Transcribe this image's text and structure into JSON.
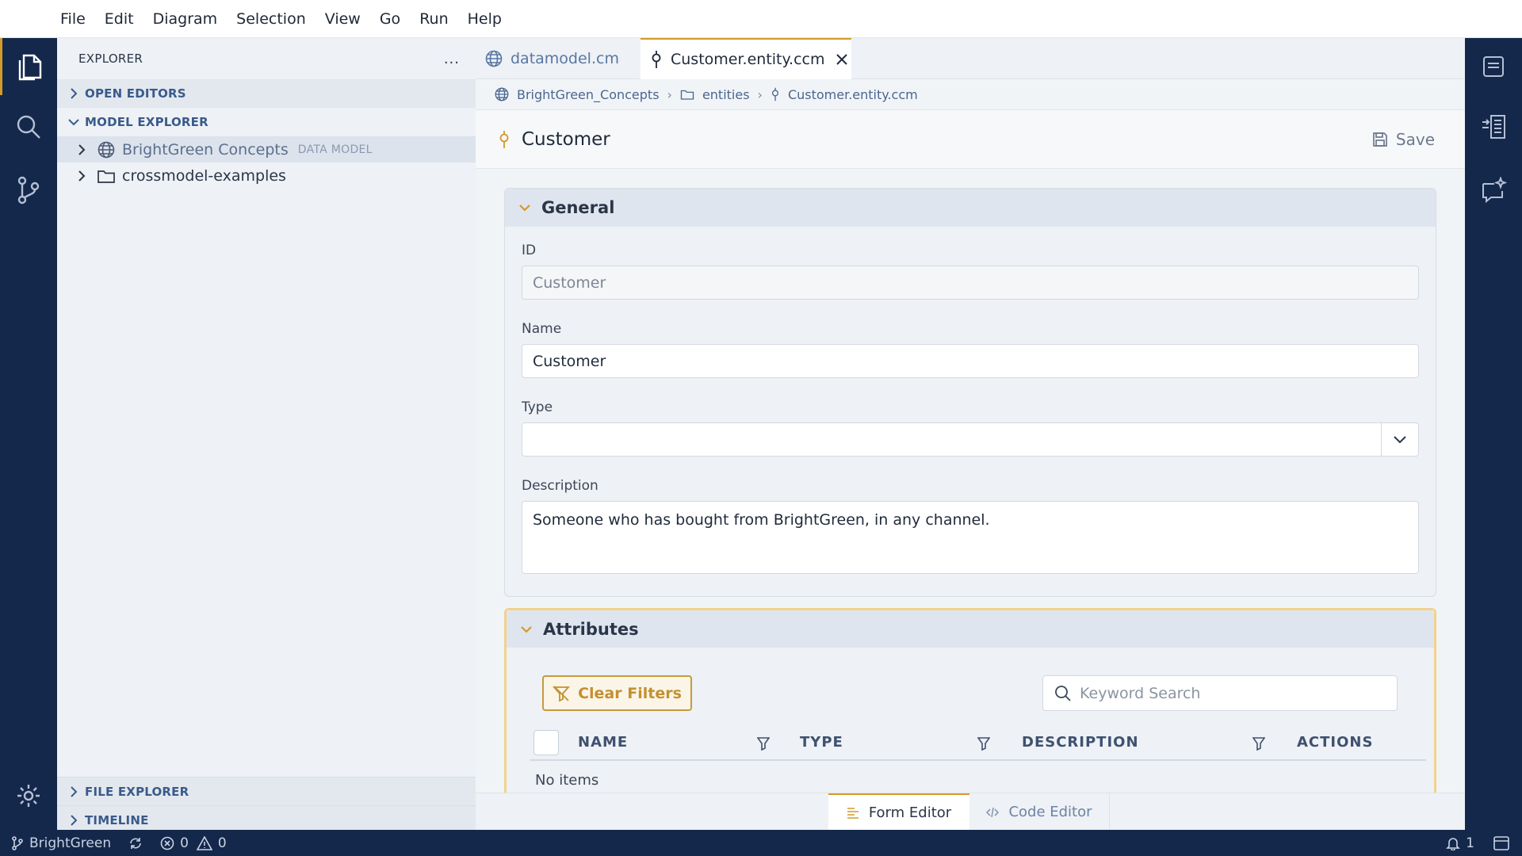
{
  "menu": [
    "File",
    "Edit",
    "Diagram",
    "Selection",
    "View",
    "Go",
    "Run",
    "Help"
  ],
  "sidebar": {
    "title": "EXPLORER",
    "more": "...",
    "open_editors": "OPEN EDITORS",
    "model_explorer": "MODEL EXPLORER",
    "tree": [
      {
        "label": "BrightGreen Concepts",
        "tag": "DATA MODEL",
        "icon": "globe-icon"
      },
      {
        "label": "crossmodel-examples",
        "icon": "folder-icon"
      }
    ],
    "file_explorer": "FILE EXPLORER",
    "timeline": "TIMELINE"
  },
  "tabs": [
    {
      "label": "datamodel.cm",
      "icon": "globe-icon",
      "active": false
    },
    {
      "label": "Customer.entity.ccm",
      "icon": "entity-icon",
      "active": true
    }
  ],
  "breadcrumb": [
    "BrightGreen_Concepts",
    "entities",
    "Customer.entity.ccm"
  ],
  "form": {
    "title": "Customer",
    "save_label": "Save",
    "general": {
      "title": "General",
      "id_label": "ID",
      "id_value": "Customer",
      "name_label": "Name",
      "name_value": "Customer",
      "type_label": "Type",
      "type_value": "",
      "description_label": "Description",
      "description_value": "Someone who has bought from BrightGreen, in any channel."
    },
    "attributes": {
      "title": "Attributes",
      "clear_filters": "Clear Filters",
      "search_placeholder": "Keyword Search",
      "columns": [
        "NAME",
        "TYPE",
        "DESCRIPTION",
        "ACTIONS"
      ],
      "empty_text": "No items"
    }
  },
  "footer_tabs": [
    "Form Editor",
    "Code Editor"
  ],
  "status": {
    "branch": "BrightGreen",
    "errors": "0",
    "warnings": "0",
    "notifications": "1"
  },
  "colors": {
    "activity": "#14284b",
    "accent": "#d49a2a",
    "link": "#5877a3"
  }
}
